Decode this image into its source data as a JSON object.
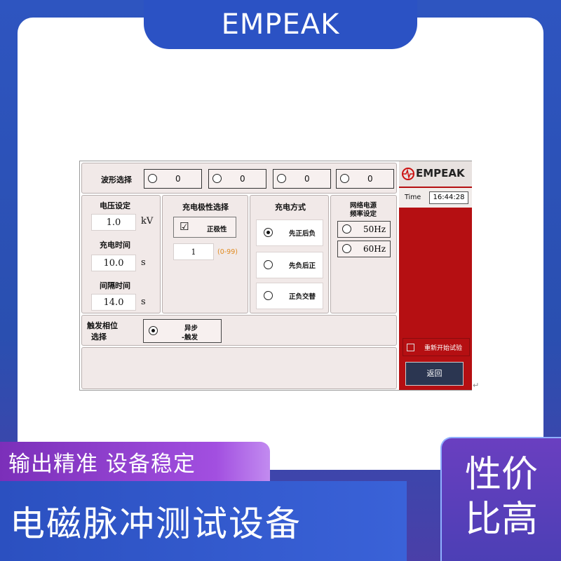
{
  "brand": "EMPEAK",
  "screen": {
    "waveform": {
      "label": "波形选择",
      "options": [
        {
          "value": "0",
          "selected": false
        },
        {
          "value": "0",
          "selected": false
        },
        {
          "value": "0",
          "selected": false
        },
        {
          "value": "0",
          "selected": false
        }
      ]
    },
    "voltage": {
      "label": "电压设定",
      "value": "1.0",
      "unit": "kV"
    },
    "charge_time": {
      "label": "充电时间",
      "value": "10.0",
      "unit": "s"
    },
    "interval_time": {
      "label": "间隔时间",
      "value": "14.0",
      "unit": "s"
    },
    "polarity": {
      "label": "充电极性选择",
      "checkbox_label": "正极性",
      "checkbox_checked": true,
      "count_value": "1",
      "count_range": "(0-99)"
    },
    "charge_mode": {
      "label": "充电方式",
      "options": [
        "先正后负",
        "先负后正",
        "正负交替"
      ],
      "selected": 0
    },
    "grid": {
      "label_line1": "网络电源",
      "label_line2": "频率设定",
      "options": [
        "50Hz",
        "60Hz"
      ]
    },
    "trigger": {
      "label_line1": "触发相位",
      "label_line2": "选择",
      "option_line1": "异步",
      "option_line2": "-触发"
    },
    "sidebar": {
      "logo": "EMPEAK",
      "time_label": "Time",
      "time_value": "16:44:28",
      "restart_label": "重新开始试验",
      "back_label": "返回"
    }
  },
  "banners": {
    "accuracy": "输出精准 设备稳定",
    "product": "电磁脉冲测试设备",
    "value_line1": "性价",
    "value_line2": "比高"
  },
  "colors": {
    "sidebar_red": "#b50f12",
    "banner_blue": "#2b50c0",
    "banner_purple": "#8a3ac8",
    "range_orange": "#e08a1e"
  }
}
